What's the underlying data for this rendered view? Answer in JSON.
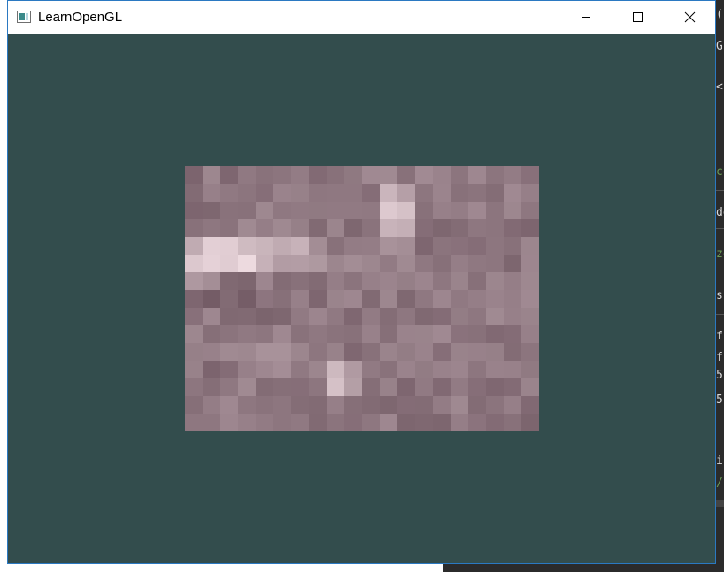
{
  "window": {
    "title": "LearnOpenGL",
    "controls": {
      "minimize": "minimize-icon",
      "maximize": "maximize-icon",
      "close": "close-icon"
    }
  },
  "colors": {
    "clear_color": "#334d4d",
    "texture_base": "#8e7780",
    "window_border": "#2b79c2",
    "titlebar": "#ffffff"
  },
  "background_editor": {
    "fragments": [
      "(",
      "G",
      "<",
      "co",
      "de",
      "ze",
      "s",
      "fi",
      "fi",
      "5",
      "5",
      "i",
      "/"
    ]
  }
}
